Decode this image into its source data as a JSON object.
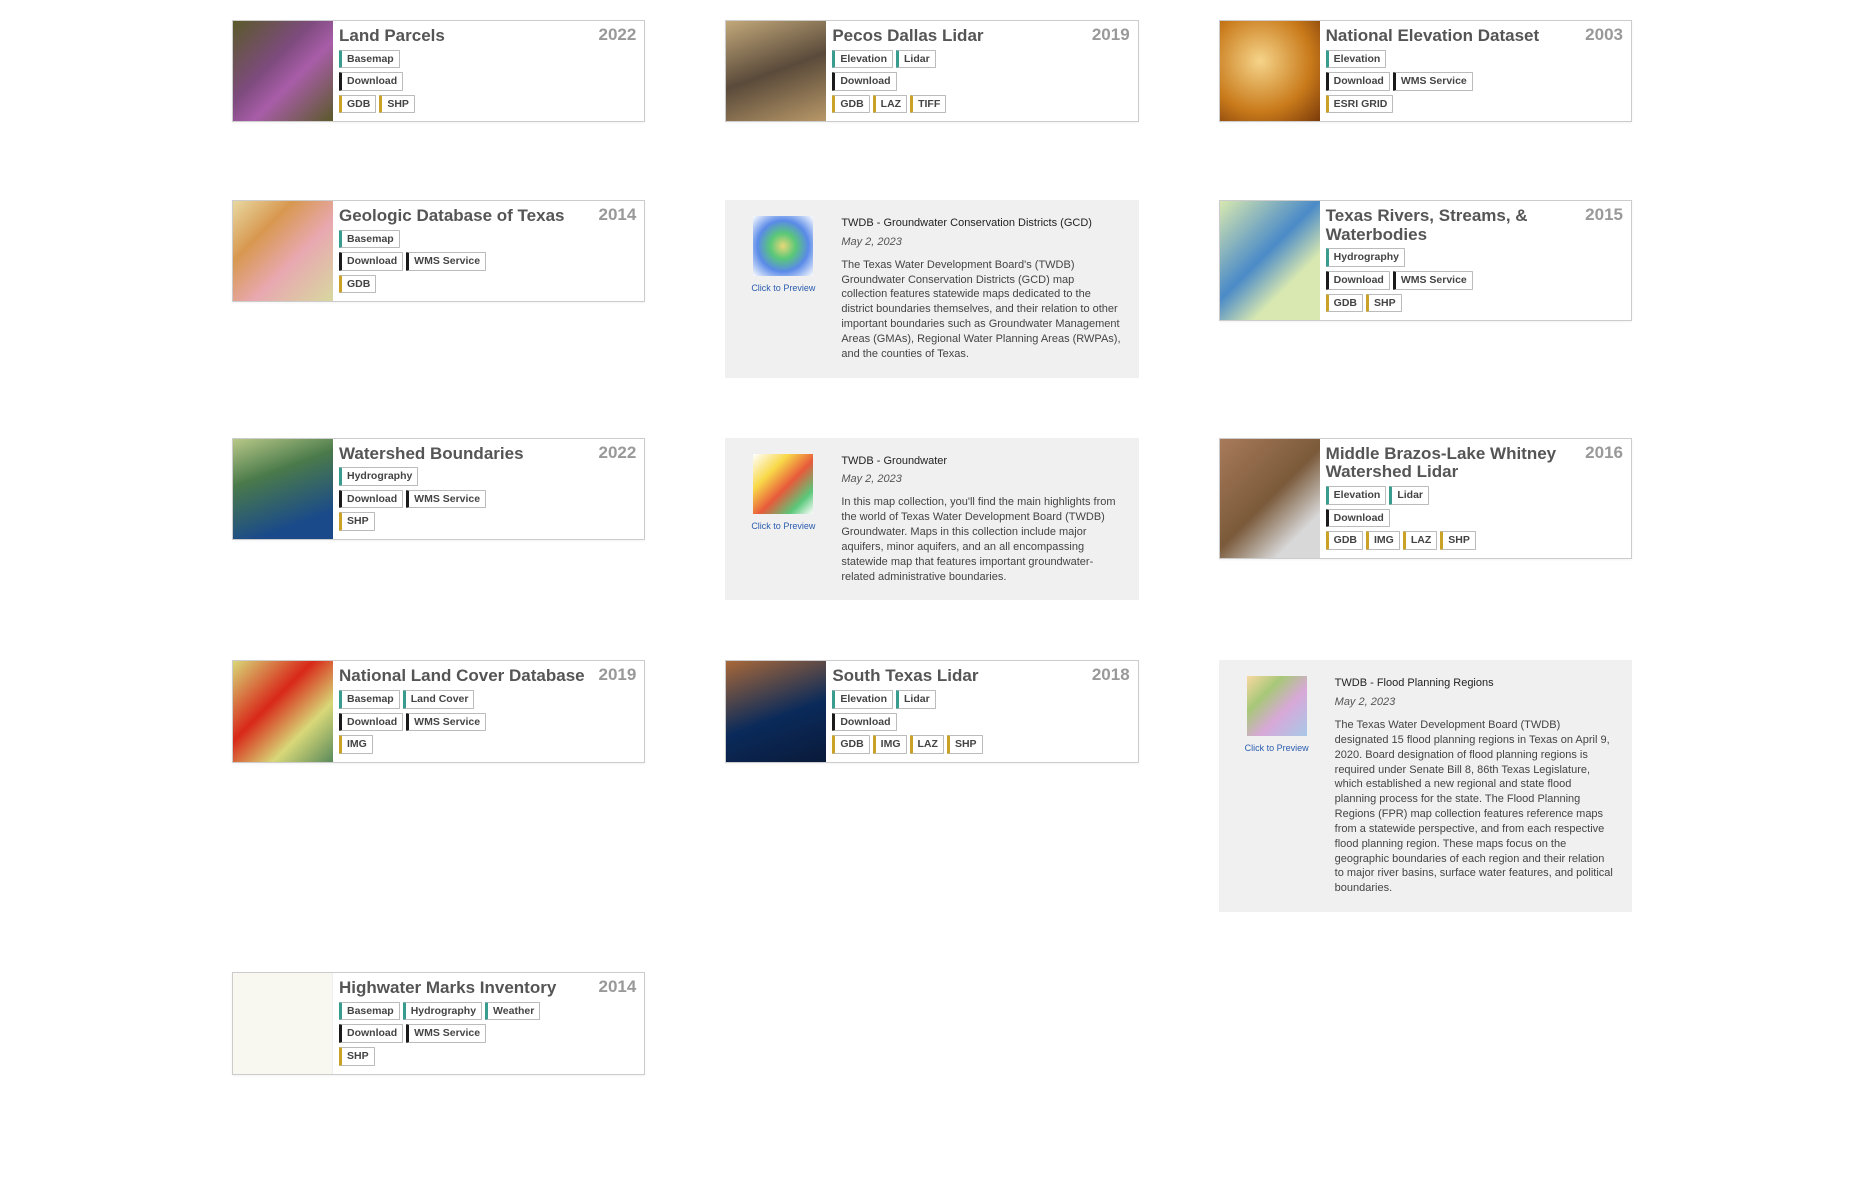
{
  "click_to_preview": "Click to Preview",
  "cards": {
    "land_parcels": {
      "title": "Land Parcels",
      "year": "2022",
      "cats": [
        "Basemap"
      ],
      "avail": [
        "Download"
      ],
      "fmts": [
        "GDB",
        "SHP"
      ]
    },
    "pecos_dallas": {
      "title": "Pecos Dallas Lidar",
      "year": "2019",
      "cats": [
        "Elevation",
        "Lidar"
      ],
      "avail": [
        "Download"
      ],
      "fmts": [
        "GDB",
        "LAZ",
        "TIFF"
      ]
    },
    "ned": {
      "title": "National Elevation Dataset",
      "year": "2003",
      "cats": [
        "Elevation"
      ],
      "avail": [
        "Download",
        "WMS Service"
      ],
      "fmts": [
        "ESRI GRID"
      ]
    },
    "geologic": {
      "title": "Geologic Database of Texas",
      "year": "2014",
      "cats": [
        "Basemap"
      ],
      "avail": [
        "Download",
        "WMS Service"
      ],
      "fmts": [
        "GDB"
      ]
    },
    "rivers": {
      "title": "Texas Rivers, Streams, & Waterbodies",
      "year": "2015",
      "cats": [
        "Hydrography"
      ],
      "avail": [
        "Download",
        "WMS Service"
      ],
      "fmts": [
        "GDB",
        "SHP"
      ]
    },
    "watershed": {
      "title": "Watershed Boundaries",
      "year": "2022",
      "cats": [
        "Hydrography"
      ],
      "avail": [
        "Download",
        "WMS Service"
      ],
      "fmts": [
        "SHP"
      ]
    },
    "brazos": {
      "title": "Middle Brazos-Lake Whitney Watershed Lidar",
      "year": "2016",
      "cats": [
        "Elevation",
        "Lidar"
      ],
      "avail": [
        "Download"
      ],
      "fmts": [
        "GDB",
        "IMG",
        "LAZ",
        "SHP"
      ]
    },
    "nlcd": {
      "title": "National Land Cover Database",
      "year": "2019",
      "cats": [
        "Basemap",
        "Land Cover"
      ],
      "avail": [
        "Download",
        "WMS Service"
      ],
      "fmts": [
        "IMG"
      ]
    },
    "stexas": {
      "title": "South Texas Lidar",
      "year": "2018",
      "cats": [
        "Elevation",
        "Lidar"
      ],
      "avail": [
        "Download"
      ],
      "fmts": [
        "GDB",
        "IMG",
        "LAZ",
        "SHP"
      ]
    },
    "hwm": {
      "title": "Highwater Marks Inventory",
      "year": "2014",
      "cats": [
        "Basemap",
        "Hydrography",
        "Weather"
      ],
      "avail": [
        "Download",
        "WMS Service"
      ],
      "fmts": [
        "SHP"
      ]
    }
  },
  "articles": {
    "gcd": {
      "title": "TWDB - Groundwater Conservation Districts (GCD)",
      "date": "May 2, 2023",
      "body": "The Texas Water Development Board's (TWDB) Groundwater Conservation Districts (GCD) map collection features statewide maps dedicated to the district boundaries themselves, and their relation to other important boundaries such as Groundwater Management Areas (GMAs), Regional Water Planning Areas (RWPAs), and the counties of Texas."
    },
    "gw": {
      "title": "TWDB - Groundwater",
      "date": "May 2, 2023",
      "body": "In this map collection, you'll find the main highlights from the world of Texas Water Development Board (TWDB) Groundwater. Maps in this collection include major aquifers, minor aquifers, and an all encompassing statewide map that features important groundwater-related administrative boundaries."
    },
    "fpr": {
      "title": "TWDB - Flood Planning Regions",
      "date": "May 2, 2023",
      "body": "The Texas Water Development Board (TWDB) designated 15 flood planning regions in Texas on April 9, 2020. Board designation of flood planning regions is required under Senate Bill 8, 86th Texas Legislature, which established a new regional and state flood planning process for the state. The Flood Planning Regions (FPR) map collection features reference maps from a statewide perspective, and from each respective flood planning region. These maps focus on the geographic boundaries of each region and their relation to major river basins, surface water features, and political boundaries."
    }
  }
}
